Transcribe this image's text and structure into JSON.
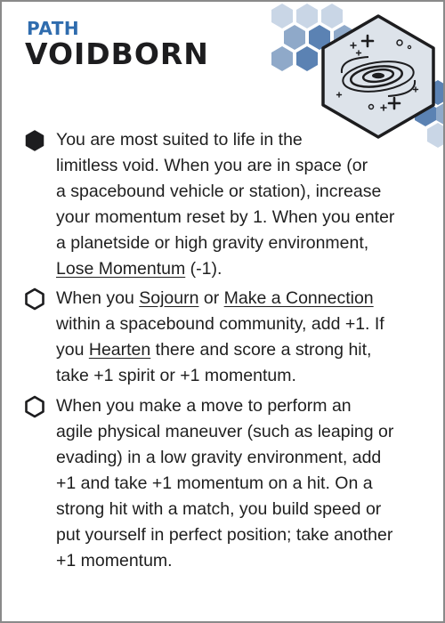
{
  "header": {
    "kicker": "PATH",
    "title": "VOIDBORN",
    "emblem_icon": "galaxy-spiral-icon"
  },
  "colors": {
    "kicker_blue": "#2f6cae",
    "hex_light": "#c9d6e6",
    "hex_mid": "#8fa9c9",
    "hex_dark": "#5b82b3",
    "emblem_fill": "#dde3ea",
    "title_dark": "#1d1d1f"
  },
  "abilities": [
    {
      "checked": true,
      "marker_icon": "filled-hexagon-icon",
      "lines": [
        "You are most suited to life in the",
        "limitless void. When you are in space (or",
        "a spacebound vehicle or station), increase",
        "your momentum reset by 1. When you enter",
        "a  planetside or high gravity environment,",
        [
          "Lose Momentum",
          " (-1)."
        ]
      ]
    },
    {
      "checked": false,
      "marker_icon": "hexagon-outline-icon",
      "lines": [
        [
          "When you ",
          "Sojourn",
          " or ",
          "Make a Connection"
        ],
        "within a spacebound community, add +1. If",
        [
          "you ",
          "Hearten",
          " there and score a strong hit,"
        ],
        "take +1 spirit or +1 momentum."
      ]
    },
    {
      "checked": false,
      "marker_icon": "hexagon-outline-icon",
      "lines": [
        "When you make a move to perform an",
        "agile physical maneuver (such as leaping or",
        "evading) in a low gravity environment, add",
        "+1 and take +1 momentum on a hit. On a",
        "strong hit with a match, you build speed or",
        "put yourself in perfect position; take another",
        "+1 momentum."
      ]
    }
  ]
}
